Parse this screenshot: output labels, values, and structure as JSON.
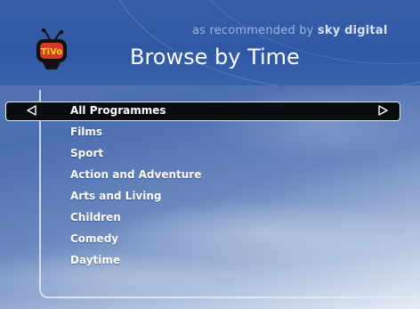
{
  "header": {
    "tagline_prefix": "as recommended by",
    "tagline_brand": "sky digital",
    "title": "Browse by Time",
    "logo_text": "TiVo"
  },
  "menu": {
    "selected_index": 0,
    "items": [
      {
        "label": "All Programmes"
      },
      {
        "label": "Films"
      },
      {
        "label": "Sport"
      },
      {
        "label": "Action and Adventure"
      },
      {
        "label": "Arts and Living"
      },
      {
        "label": "Children"
      },
      {
        "label": "Comedy"
      },
      {
        "label": "Daytime"
      }
    ]
  },
  "icons": {
    "left": "chevron-left-icon",
    "right": "chevron-right-icon"
  },
  "colors": {
    "header": "#2f58a5",
    "highlight": "#0b0b12",
    "text": "#ffffff"
  }
}
